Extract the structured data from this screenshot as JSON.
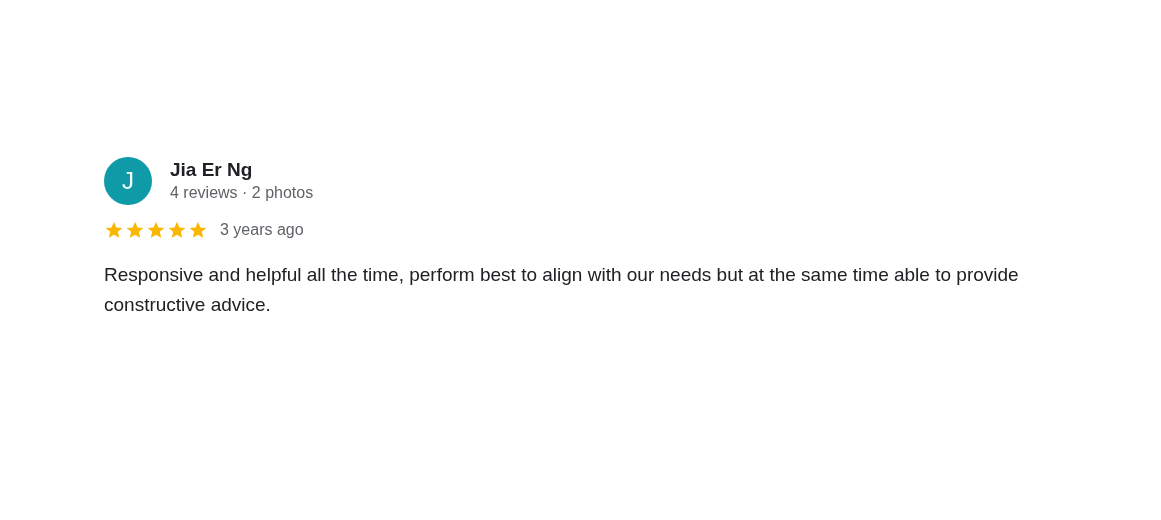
{
  "review": {
    "avatar_letter": "J",
    "color": "#0f9aa8",
    "author": "Jia Er Ng",
    "meta": "4 reviews · 2 photos",
    "stars": 5,
    "time": "3 years ago",
    "text": "Responsive and helpful all the time, perform best to align with our needs but at the same time able to provide constructive advice."
  }
}
